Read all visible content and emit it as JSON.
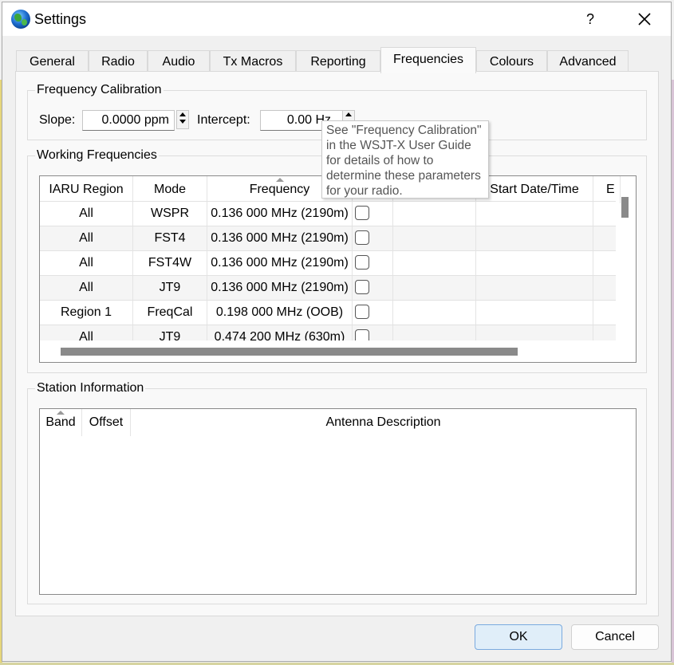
{
  "window": {
    "title": "Settings",
    "help_label": "?"
  },
  "tabs": [
    {
      "label": "General"
    },
    {
      "label": "Radio"
    },
    {
      "label": "Audio"
    },
    {
      "label": "Tx Macros"
    },
    {
      "label": "Reporting"
    },
    {
      "label": "Frequencies",
      "active": true
    },
    {
      "label": "Colours"
    },
    {
      "label": "Advanced"
    }
  ],
  "frequency_calibration": {
    "title": "Frequency Calibration",
    "slope_label": "Slope:",
    "slope_value": "0.0000 ppm",
    "intercept_label": "Intercept:",
    "intercept_value": "0.00 Hz"
  },
  "tooltip": {
    "lines": [
      "See \"Frequency Calibration\"",
      "in the WSJT-X User Guide",
      "for details of how to",
      "determine these parameters",
      "for your radio."
    ]
  },
  "working_frequencies": {
    "title": "Working Frequencies",
    "columns": [
      "IARU Region",
      "Mode",
      "Frequency",
      "",
      "",
      "Start Date/Time",
      "E"
    ],
    "rows": [
      {
        "region": "All",
        "mode": "WSPR",
        "frequency": "0.136 000 MHz (2190m)"
      },
      {
        "region": "All",
        "mode": "FST4",
        "frequency": "0.136 000 MHz (2190m)"
      },
      {
        "region": "All",
        "mode": "FST4W",
        "frequency": "0.136 000 MHz (2190m)"
      },
      {
        "region": "All",
        "mode": "JT9",
        "frequency": "0.136 000 MHz (2190m)"
      },
      {
        "region": "Region 1",
        "mode": "FreqCal",
        "frequency": "0.198 000 MHz (OOB)"
      },
      {
        "region": "All",
        "mode": "JT9",
        "frequency": "0.474 200 MHz (630m)"
      }
    ]
  },
  "station_information": {
    "title": "Station Information",
    "columns": [
      "Band",
      "Offset",
      "Antenna Description"
    ]
  },
  "buttons": {
    "ok": "OK",
    "cancel": "Cancel"
  },
  "colors": {
    "default_button_bg": "#e0eef9",
    "default_button_border": "#7aaadf",
    "tooltip_text": "#555555"
  }
}
